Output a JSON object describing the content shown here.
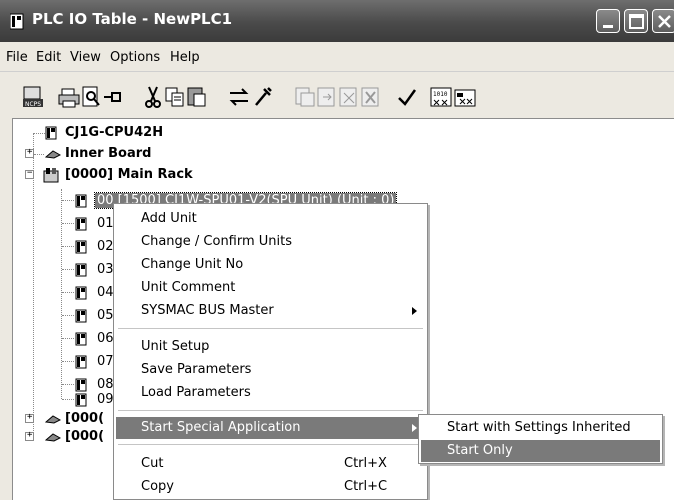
{
  "window": {
    "title": "PLC IO Table - NewPLC1"
  },
  "menubar": {
    "items": [
      "File",
      "Edit",
      "View",
      "Options",
      "Help"
    ]
  },
  "toolbar": {
    "icons": [
      "ncps-icon",
      "print-icon",
      "print-preview-icon",
      "pin-icon",
      "cut-icon",
      "copy-icon",
      "paste-icon",
      "transfer-icon",
      "tools-icon",
      "compare-icon",
      "transfer-to-plc-icon",
      "transfer-from-plc-icon",
      "delete-icon",
      "check-icon",
      "io-table-icon",
      "io-config-icon"
    ]
  },
  "tree": {
    "cpu": "CJ1G-CPU42H",
    "inner_board": "Inner Board",
    "main_rack": "[0000] Main Rack",
    "selected_unit": "00 [1500] CJ1W-SPU01-V2(SPU Unit) (Unit : 0)",
    "slots": [
      "01",
      "02",
      "03",
      "04",
      "05",
      "06",
      "07",
      "08",
      "09"
    ],
    "collapsed_racks": [
      "[000(",
      "[000("
    ]
  },
  "context_menu": {
    "items": [
      {
        "label": "Add Unit"
      },
      {
        "label": "Change / Confirm Units"
      },
      {
        "label": "Change Unit No"
      },
      {
        "label": "Unit Comment"
      },
      {
        "label": "SYSMAC BUS Master",
        "submenu": true
      },
      {
        "label": "Unit Setup"
      },
      {
        "label": "Save Parameters"
      },
      {
        "label": "Load Parameters"
      },
      {
        "label": "Start Special Application",
        "submenu": true,
        "highlighted": true
      },
      {
        "label": "Cut",
        "shortcut": "Ctrl+X"
      },
      {
        "label": "Copy",
        "shortcut": "Ctrl+C"
      }
    ]
  },
  "submenu": {
    "items": [
      {
        "label": "Start with Settings Inherited"
      },
      {
        "label": "Start Only",
        "highlighted": true
      }
    ]
  },
  "colors": {
    "titlebar": "#4a4a4a",
    "highlight": "#7a7a7a",
    "menu_bg": "#ece9e1"
  }
}
